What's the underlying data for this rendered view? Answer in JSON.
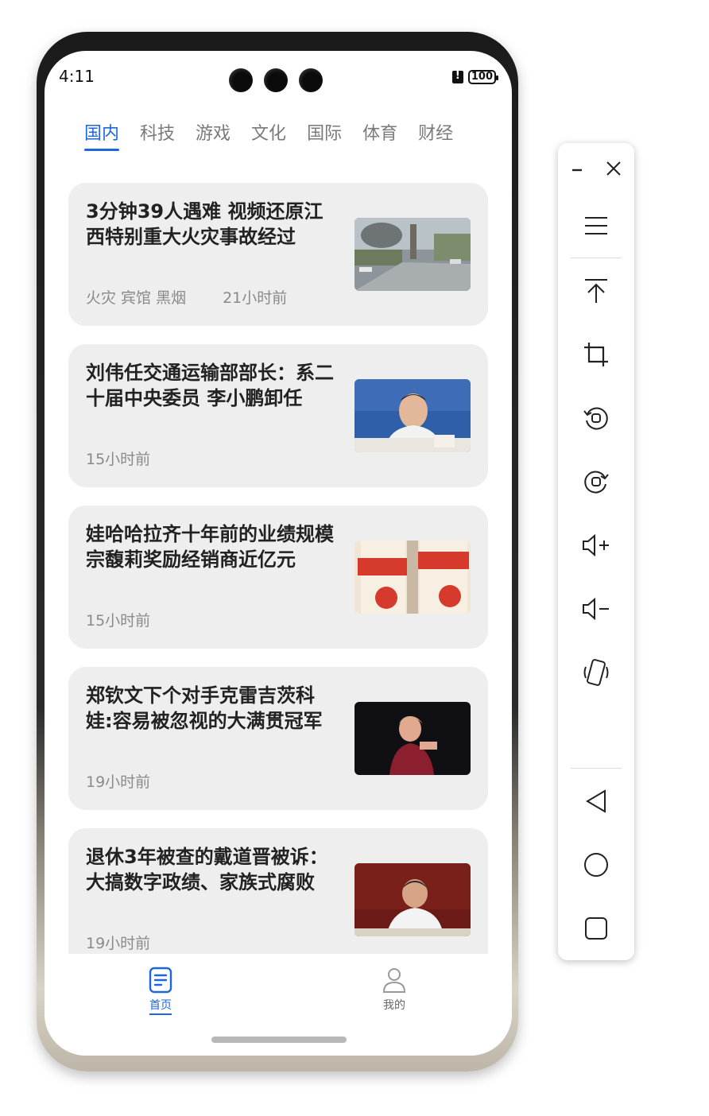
{
  "status_bar": {
    "time": "4:11",
    "battery": "100"
  },
  "tabs": [
    {
      "label": "国内",
      "active": true
    },
    {
      "label": "科技",
      "active": false
    },
    {
      "label": "游戏",
      "active": false
    },
    {
      "label": "文化",
      "active": false
    },
    {
      "label": "国际",
      "active": false
    },
    {
      "label": "体育",
      "active": false
    },
    {
      "label": "财经",
      "active": false
    }
  ],
  "news": [
    {
      "title": "3分钟39人遇难 视频还原江西特别重大火灾事故经过",
      "tags": "火灾 宾馆 黑烟",
      "time": "21小时前",
      "thumb": "street-fire-photo"
    },
    {
      "title": "刘伟任交通运输部部长：系二十届中央委员 李小鹏卸任",
      "tags": "",
      "time": "15小时前",
      "thumb": "official-speaking-photo"
    },
    {
      "title": "娃哈哈拉齐十年前的业绩规模 宗馥莉奖励经销商近亿元",
      "tags": "",
      "time": "15小时前",
      "thumb": "wahaha-bottles-photo"
    },
    {
      "title": "郑钦文下个对手克雷吉茨科娃:容易被忽视的大满贯冠军",
      "tags": "",
      "time": "19小时前",
      "thumb": "tennis-player-photo"
    },
    {
      "title": "退休3年被查的戴道晋被诉：大搞数字政绩、家族式腐败",
      "tags": "",
      "time": "19小时前",
      "thumb": "official-meeting-photo"
    }
  ],
  "bottom_nav": {
    "home_label": "首页",
    "mine_label": "我的"
  },
  "toolbar": {
    "icons": [
      "minimize-icon",
      "close-icon",
      "menu-icon",
      "scroll-top-icon",
      "crop-icon",
      "rotate-left-icon",
      "rotate-right-icon",
      "volume-up-icon",
      "volume-down-icon",
      "shake-icon",
      "back-icon",
      "home-icon",
      "recents-icon"
    ]
  },
  "colors": {
    "accent": "#1d67d9",
    "card": "#eeeeee"
  }
}
